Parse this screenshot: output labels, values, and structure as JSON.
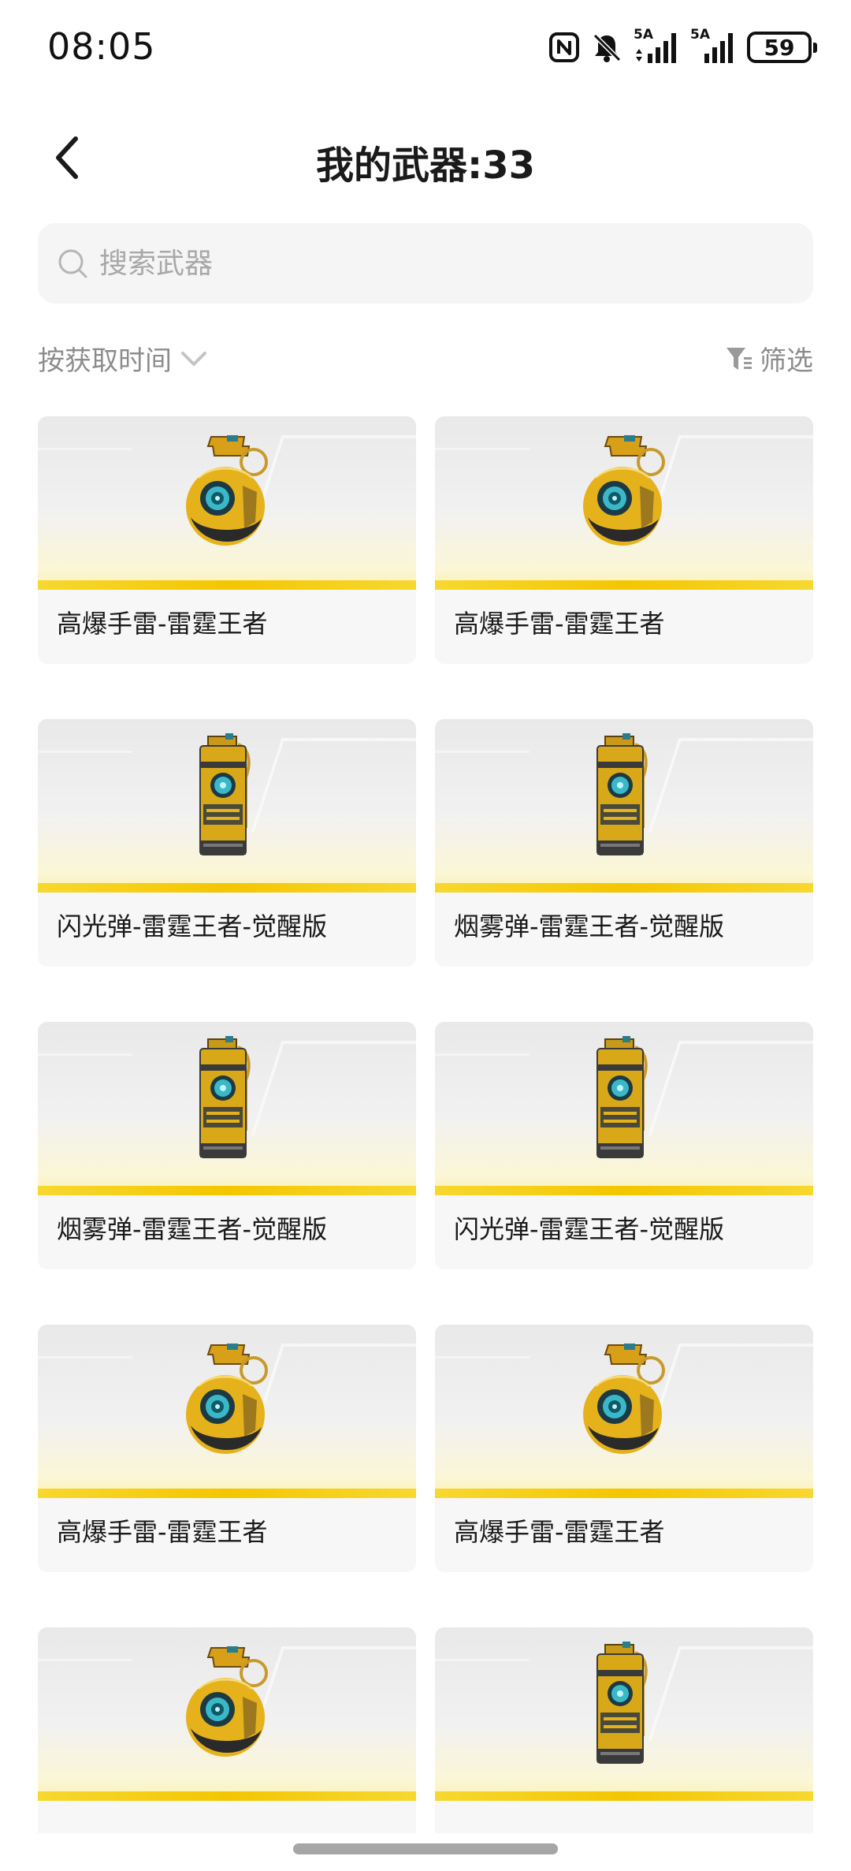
{
  "status_bar": {
    "time": "08:05",
    "network_1": "5A",
    "network_2": "5A",
    "battery": "59",
    "icons": [
      "nfc-icon",
      "bell-muted-icon",
      "signal-icon",
      "signal-icon",
      "battery-icon"
    ]
  },
  "header": {
    "title": "我的武器:33",
    "back_icon": "chevron-left-icon"
  },
  "search": {
    "placeholder": "搜索武器",
    "value": ""
  },
  "sort": {
    "label": "按获取时间",
    "icon": "chevron-down-icon"
  },
  "filter": {
    "label": "筛选",
    "icon": "filter-icon"
  },
  "weapons": [
    {
      "name": "高爆手雷-雷霆王者",
      "kind": "grenade"
    },
    {
      "name": "高爆手雷-雷霆王者",
      "kind": "grenade"
    },
    {
      "name": "闪光弹-雷霆王者-觉醒版",
      "kind": "canister"
    },
    {
      "name": "烟雾弹-雷霆王者-觉醒版",
      "kind": "canister"
    },
    {
      "name": "烟雾弹-雷霆王者-觉醒版",
      "kind": "canister"
    },
    {
      "name": "闪光弹-雷霆王者-觉醒版",
      "kind": "canister"
    },
    {
      "name": "高爆手雷-雷霆王者",
      "kind": "grenade"
    },
    {
      "name": "高爆手雷-雷霆王者",
      "kind": "grenade"
    },
    {
      "name": "",
      "kind": "grenade"
    },
    {
      "name": "",
      "kind": "canister"
    }
  ],
  "colors": {
    "accent_yellow": "#f4c600",
    "card_bg": "#f7f7f7",
    "search_bg": "#f5f5f5",
    "muted_text": "#8c8c8c"
  }
}
